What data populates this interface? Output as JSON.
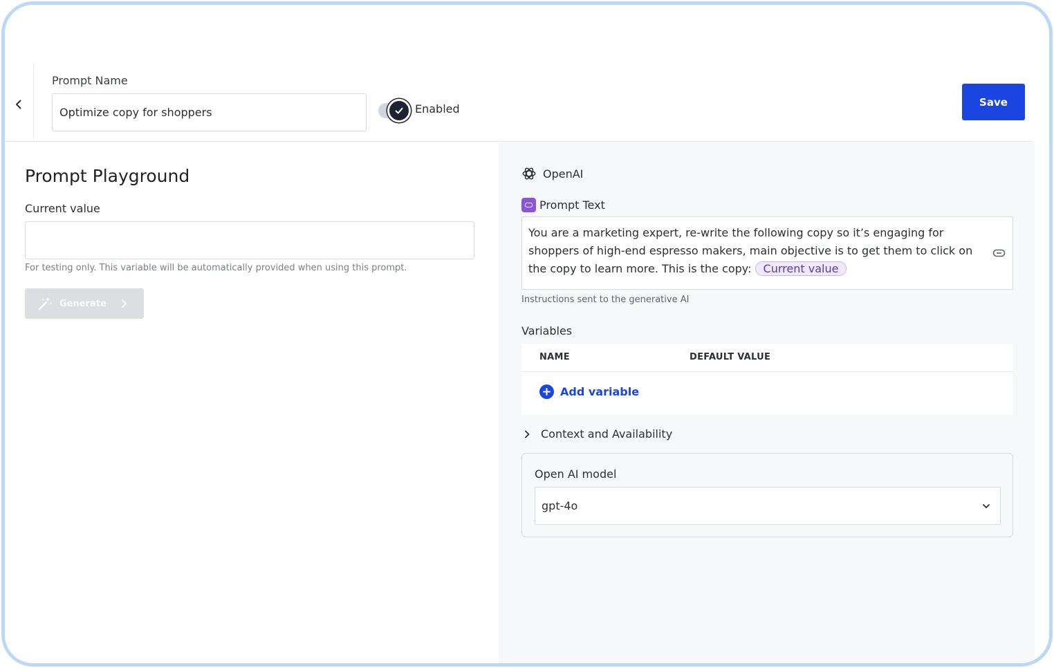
{
  "header": {
    "prompt_name_label": "Prompt Name",
    "prompt_name_value": "Optimize copy for shoppers",
    "enabled_label": "Enabled",
    "enabled": true,
    "save_label": "Save"
  },
  "playground": {
    "title": "Prompt Playground",
    "current_value_label": "Current value",
    "current_value": "",
    "help_text": "For testing only. This variable will be automatically provided when using this prompt.",
    "generate_label": "Generate"
  },
  "config": {
    "provider": "OpenAI",
    "prompt_text_label": "Prompt Text",
    "prompt_text": "You are a marketing expert, re-write the following copy so it’s engaging for shoppers of high-end espresso makers, main objective is to get them to click on the copy to learn more. This is the copy:",
    "prompt_variable_chip": "Current value",
    "instructions": "Instructions sent to the generative AI",
    "variables_label": "Variables",
    "variables_columns": [
      "NAME",
      "DEFAULT VALUE"
    ],
    "add_variable_label": "Add variable",
    "context_label": "Context and Availability",
    "model_label": "Open AI model",
    "model_value": "gpt-4o"
  },
  "colors": {
    "accent": "#1a45e0",
    "chip_bg": "#efe9fa",
    "chip_text": "#5b39b8",
    "prompt_icon": "#8a56d6",
    "frame_border": "#bcd8f7"
  },
  "icons": [
    "chevron-left-icon",
    "check-icon",
    "wand-icon",
    "chevron-right-icon",
    "openai-logo-icon",
    "prompt-text-icon",
    "link-icon",
    "plus-icon",
    "chevron-down-icon"
  ]
}
